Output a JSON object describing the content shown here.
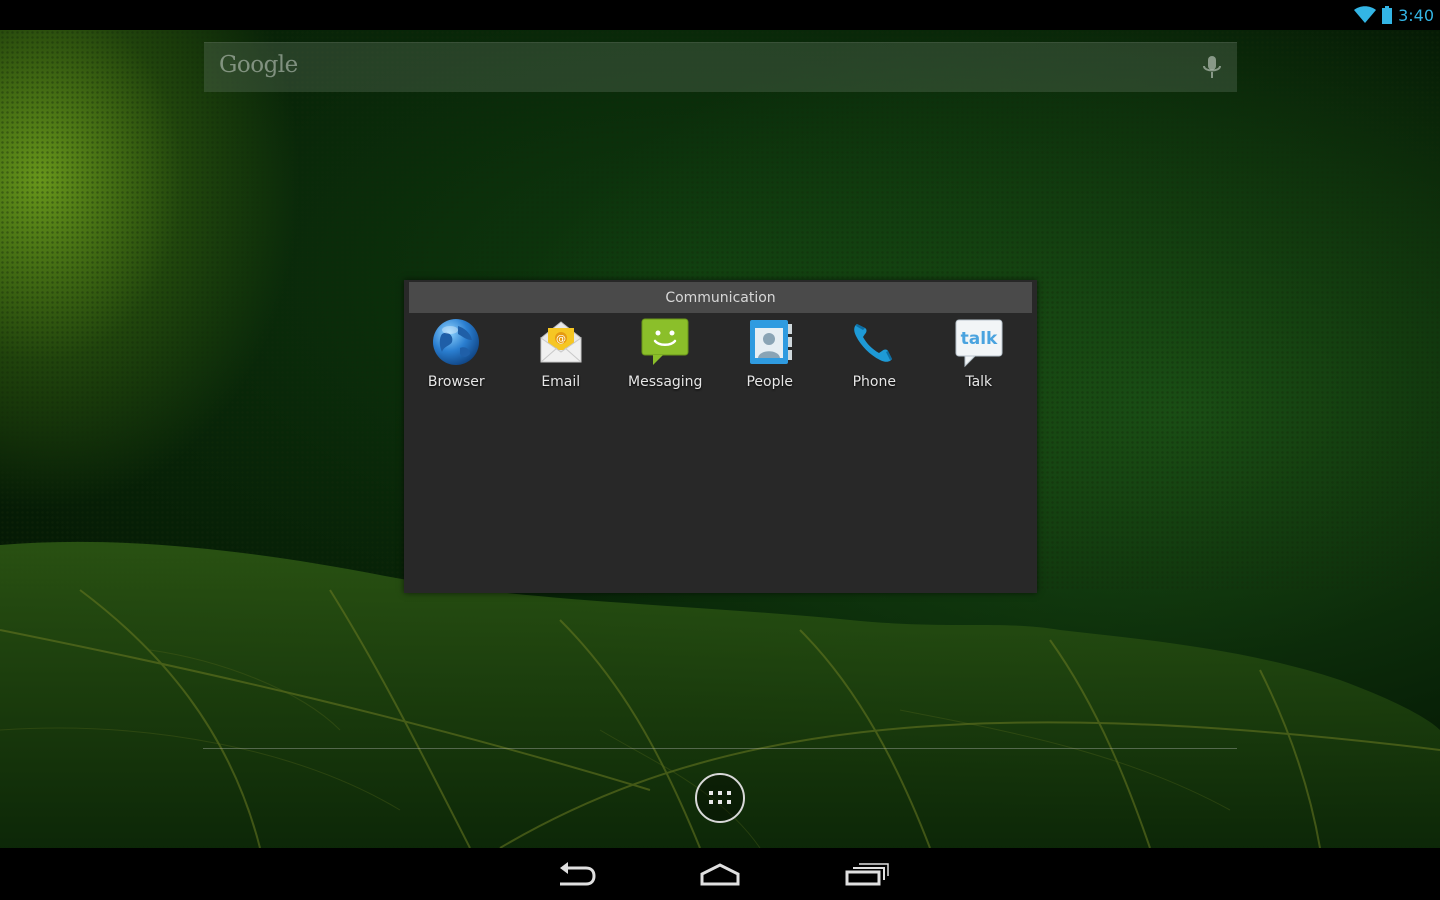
{
  "status_bar": {
    "time": "3:40",
    "icons": [
      "wifi-icon",
      "battery-icon"
    ],
    "accent_color": "#33b5e5"
  },
  "search": {
    "logo": "Google",
    "icon": "mic-icon"
  },
  "folder": {
    "title": "Communication",
    "apps": [
      {
        "label": "Browser",
        "icon": "browser-icon"
      },
      {
        "label": "Email",
        "icon": "email-icon"
      },
      {
        "label": "Messaging",
        "icon": "messaging-icon"
      },
      {
        "label": "People",
        "icon": "people-icon"
      },
      {
        "label": "Phone",
        "icon": "phone-icon"
      },
      {
        "label": "Talk",
        "icon": "talk-icon",
        "icon_text": "talk"
      }
    ]
  },
  "hotseat": {
    "all_apps_icon": "all-apps-icon"
  },
  "nav_bar": {
    "buttons": [
      "back-icon",
      "home-icon",
      "recents-icon"
    ]
  }
}
